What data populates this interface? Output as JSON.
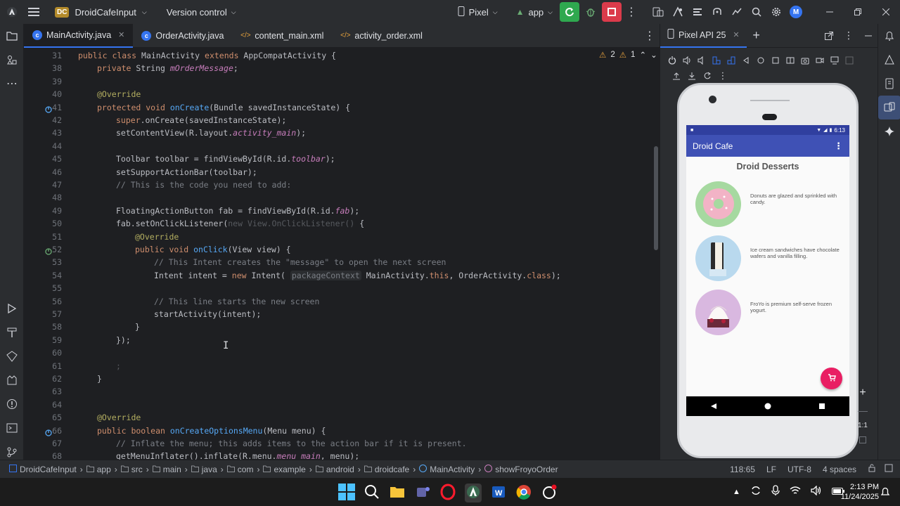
{
  "window": {
    "project_badge": "DC",
    "project_name": "DroidCafeInput",
    "vcs_label": "Version control",
    "device": "Pixel",
    "run_config": "app",
    "user_initial": "M"
  },
  "tabs": [
    {
      "label": "MainActivity.java",
      "type": "class",
      "active": true
    },
    {
      "label": "OrderActivity.java",
      "type": "class",
      "active": false
    },
    {
      "label": "content_main.xml",
      "type": "xml",
      "active": false
    },
    {
      "label": "activity_order.xml",
      "type": "xml",
      "active": false
    }
  ],
  "editor": {
    "warnings_count": "2",
    "weak_warnings_count": "1",
    "lines": [
      {
        "n": "31",
        "indent": 1,
        "parts": [
          [
            "kw",
            "public class "
          ],
          [
            "ty",
            "MainActivity "
          ],
          [
            "kw",
            "extends "
          ],
          [
            "ty",
            "AppCompatActivity {"
          ]
        ]
      },
      {
        "n": "38",
        "indent": 2,
        "parts": [
          [
            "kw",
            "private "
          ],
          [
            "ty",
            "String "
          ],
          [
            "it",
            "mOrderMessage"
          ],
          [
            "ty",
            ";"
          ]
        ]
      },
      {
        "n": "39",
        "indent": 0,
        "parts": []
      },
      {
        "n": "40",
        "indent": 2,
        "parts": [
          [
            "an",
            "@Override"
          ]
        ]
      },
      {
        "n": "41",
        "indent": 2,
        "gutter": "override",
        "parts": [
          [
            "kw",
            "protected void "
          ],
          [
            "fn",
            "onCreate"
          ],
          [
            "ty",
            "(Bundle savedInstanceState) {"
          ]
        ]
      },
      {
        "n": "42",
        "indent": 3,
        "parts": [
          [
            "kw",
            "super"
          ],
          [
            "ty",
            ".onCreate(savedInstanceState);"
          ]
        ]
      },
      {
        "n": "43",
        "indent": 3,
        "parts": [
          [
            "ty",
            "setContentView(R.layout."
          ],
          [
            "it",
            "activity_main"
          ],
          [
            "ty",
            ");"
          ]
        ]
      },
      {
        "n": "44",
        "indent": 0,
        "parts": []
      },
      {
        "n": "45",
        "indent": 3,
        "parts": [
          [
            "ty",
            "Toolbar toolbar = findViewById(R.id."
          ],
          [
            "it",
            "toolbar"
          ],
          [
            "ty",
            ");"
          ]
        ]
      },
      {
        "n": "46",
        "indent": 3,
        "parts": [
          [
            "ty",
            "setSupportActionBar(toolbar);"
          ]
        ]
      },
      {
        "n": "47",
        "indent": 3,
        "parts": [
          [
            "cm",
            "// This is the code you need to add:"
          ]
        ]
      },
      {
        "n": "48",
        "indent": 0,
        "parts": []
      },
      {
        "n": "49",
        "indent": 3,
        "parts": [
          [
            "ty",
            "FloatingActionButton fab = findViewById(R.id."
          ],
          [
            "it",
            "fab"
          ],
          [
            "ty",
            ");"
          ]
        ]
      },
      {
        "n": "50",
        "indent": 3,
        "parts": [
          [
            "ty",
            "fab.setOnClickListener("
          ],
          [
            "dim",
            "new View.OnClickListener() "
          ],
          [
            "ty",
            "{"
          ]
        ]
      },
      {
        "n": "51",
        "indent": 4,
        "parts": [
          [
            "an",
            "@Override"
          ]
        ]
      },
      {
        "n": "52",
        "indent": 4,
        "gutter": "implement",
        "parts": [
          [
            "kw",
            "public void "
          ],
          [
            "fn",
            "onClick"
          ],
          [
            "ty",
            "(View view) {"
          ]
        ]
      },
      {
        "n": "53",
        "indent": 5,
        "parts": [
          [
            "cm",
            "// This Intent creates the \"message\" to open the next screen"
          ]
        ]
      },
      {
        "n": "54",
        "indent": 5,
        "parts": [
          [
            "ty",
            "Intent intent = "
          ],
          [
            "kw",
            "new "
          ],
          [
            "ty",
            "Intent( "
          ],
          [
            "hint",
            "packageContext"
          ],
          [
            "ty",
            " MainActivity."
          ],
          [
            "kw",
            "this"
          ],
          [
            "ty",
            ", OrderActivity."
          ],
          [
            "kw",
            "class"
          ],
          [
            "ty",
            ");"
          ]
        ]
      },
      {
        "n": "55",
        "indent": 0,
        "parts": []
      },
      {
        "n": "56",
        "indent": 5,
        "parts": [
          [
            "cm",
            "// This line starts the new screen"
          ]
        ]
      },
      {
        "n": "57",
        "indent": 5,
        "parts": [
          [
            "ty",
            "startActivity(intent);"
          ]
        ]
      },
      {
        "n": "58",
        "indent": 4,
        "parts": [
          [
            "ty",
            "}"
          ]
        ]
      },
      {
        "n": "59",
        "indent": 3,
        "parts": [
          [
            "ty",
            "});"
          ]
        ]
      },
      {
        "n": "60",
        "indent": 0,
        "parts": []
      },
      {
        "n": "61",
        "indent": 3,
        "parts": [
          [
            "dim",
            ";"
          ]
        ]
      },
      {
        "n": "62",
        "indent": 2,
        "parts": [
          [
            "ty",
            "}"
          ]
        ]
      },
      {
        "n": "63",
        "indent": 0,
        "parts": []
      },
      {
        "n": "64",
        "indent": 0,
        "parts": []
      },
      {
        "n": "65",
        "indent": 2,
        "parts": [
          [
            "an",
            "@Override"
          ]
        ]
      },
      {
        "n": "66",
        "indent": 2,
        "gutter": "override",
        "parts": [
          [
            "kw",
            "public boolean "
          ],
          [
            "fn",
            "onCreateOptionsMenu"
          ],
          [
            "ty",
            "(Menu menu) {"
          ]
        ]
      },
      {
        "n": "67",
        "indent": 3,
        "parts": [
          [
            "cm",
            "// Inflate the menu; this adds items to the action bar if it is present."
          ]
        ]
      },
      {
        "n": "68",
        "indent": 3,
        "parts": [
          [
            "ty",
            "getMenuInflater().inflate(R.menu."
          ],
          [
            "it",
            "menu_main"
          ],
          [
            "ty",
            ", menu);"
          ]
        ]
      }
    ]
  },
  "emulator": {
    "tab_label": "Pixel API 25",
    "zoom_label": "1:1",
    "phone": {
      "status_time": "6:13",
      "app_title": "Droid Cafe",
      "heading": "Droid Desserts",
      "items": [
        {
          "text": "Donuts are glazed and sprinkled with candy.",
          "kind": "donut"
        },
        {
          "text": "Ice cream sandwiches have chocolate wafers and vanilla filling.",
          "kind": "icecream"
        },
        {
          "text": "FroYo is premium self-serve frozen yogurt.",
          "kind": "froyo"
        }
      ]
    }
  },
  "breadcrumb": [
    "DroidCafeInput",
    "app",
    "src",
    "main",
    "java",
    "com",
    "example",
    "android",
    "droidcafe",
    "MainActivity",
    "showFroyoOrder"
  ],
  "status": {
    "position": "118:65",
    "line_sep": "LF",
    "encoding": "UTF-8",
    "indent": "4 spaces"
  },
  "taskbar": {
    "time": "2:13 PM",
    "date": "11/24/2025"
  },
  "colors": {
    "accent": "#3574f0",
    "app_bar": "#3f51b5",
    "fab": "#e91e63",
    "stop": "#db3b4b",
    "run": "#2fa84f"
  }
}
